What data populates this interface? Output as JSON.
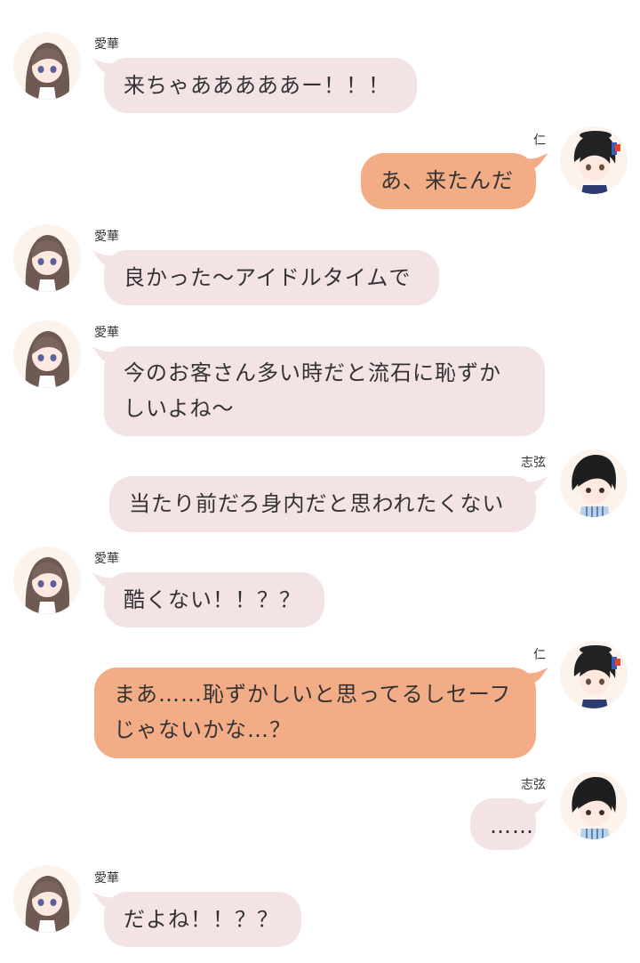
{
  "messages": [
    {
      "speaker": "愛華",
      "text": "来ちゃあああああー！！！",
      "side": "left",
      "color": "pink"
    },
    {
      "speaker": "仁",
      "text": "あ、来たんだ",
      "side": "right",
      "color": "orange"
    },
    {
      "speaker": "愛華",
      "text": "良かった〜アイドルタイムで",
      "side": "left",
      "color": "pink"
    },
    {
      "speaker": "愛華",
      "text_lines": [
        "今のお客さん多い時だと流石に恥ずか",
        "しいよね〜"
      ],
      "side": "left",
      "color": "pink"
    },
    {
      "speaker": "志弦",
      "text": "当たり前だろ身内だと思われたくない",
      "side": "right",
      "color": "pink"
    },
    {
      "speaker": "愛華",
      "text": "酷くない！！？？",
      "side": "left",
      "color": "pink"
    },
    {
      "speaker": "仁",
      "text_lines": [
        "まあ……恥ずかしいと思ってるしセーフ",
        "じゃないかな…？"
      ],
      "side": "right",
      "color": "orange"
    },
    {
      "speaker": "志弦",
      "text": "……",
      "side": "right",
      "color": "pink"
    },
    {
      "speaker": "愛華",
      "text": "だよね！！？？",
      "side": "left",
      "color": "pink"
    }
  ],
  "colors": {
    "pink_bubble": "#f3e3e5",
    "orange_bubble": "#f3ad86",
    "background": "#ffffff"
  }
}
